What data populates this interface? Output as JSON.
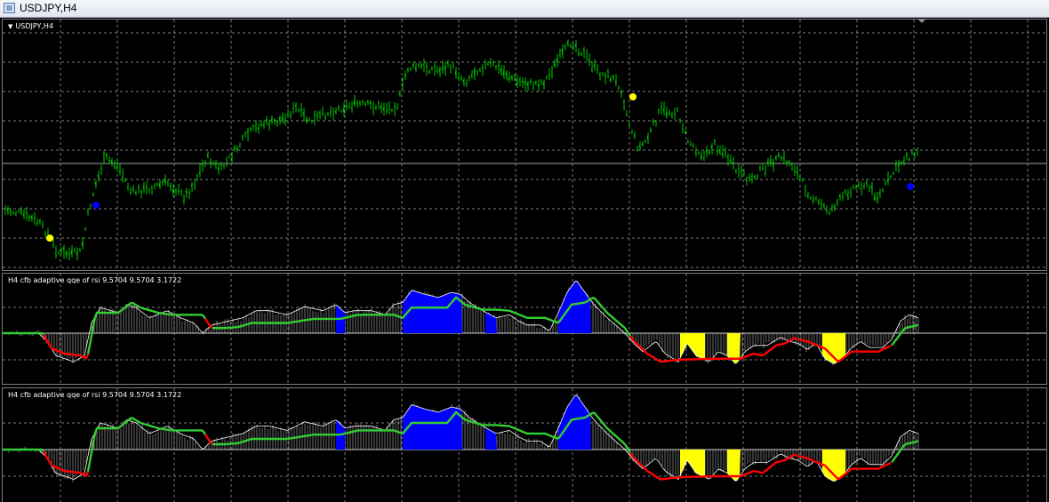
{
  "window": {
    "title": "USDJPY,H4"
  },
  "main_chart": {
    "label": "USDJPY,H4",
    "colors": {
      "background": "#000000",
      "grid": "#7a7a7a",
      "bull": "#00c800",
      "arrow_yellow": "#ffff00",
      "arrow_blue": "#0000ff"
    }
  },
  "indicator_panels": [
    {
      "label": "H4  cfb adaptive qqe of rsi 9.5704 9.5704 3.1722"
    },
    {
      "label": "H4  cfb adaptive qqe of rsi 9.5704 9.5704 3.1722"
    }
  ],
  "indicator_colors": {
    "line_up": "#32cd32",
    "line_down": "#ff0000",
    "histogram": "#ffffff",
    "fill_up": "#0000ff",
    "fill_down": "#ffff00"
  },
  "chart_data": {
    "type": "table",
    "symbol": "USDJPY",
    "timeframe": "H4"
  }
}
